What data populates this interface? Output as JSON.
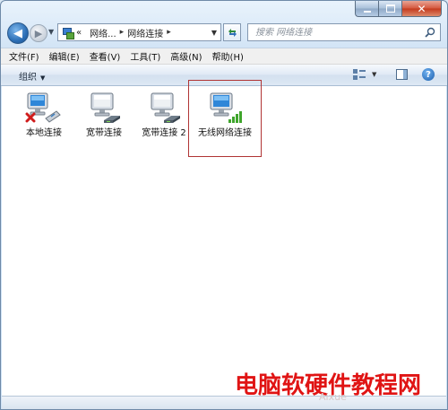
{
  "address": {
    "overflow": "«",
    "crumbs": [
      "网络...",
      "网络连接"
    ]
  },
  "search": {
    "placeholder": "搜索 网络连接"
  },
  "menu": [
    "文件(F)",
    "编辑(E)",
    "查看(V)",
    "工具(T)",
    "高级(N)",
    "帮助(H)"
  ],
  "toolbar": {
    "organize": "组织"
  },
  "items": [
    {
      "label": "本地连接",
      "icon": "local-connection-icon",
      "status": "disconnected"
    },
    {
      "label": "宽带连接",
      "icon": "broadband-connection-icon"
    },
    {
      "label": "宽带连接 2",
      "icon": "broadband-connection-icon"
    },
    {
      "label": "无线网络连接",
      "icon": "wireless-connection-icon",
      "selected": true
    }
  ],
  "watermark": {
    "text": "电脑软硬件教程网",
    "site": "Aixue"
  },
  "colors": {
    "accent": "#3a7fd0",
    "selection_border": "#b03434",
    "watermark": "#e01414"
  }
}
